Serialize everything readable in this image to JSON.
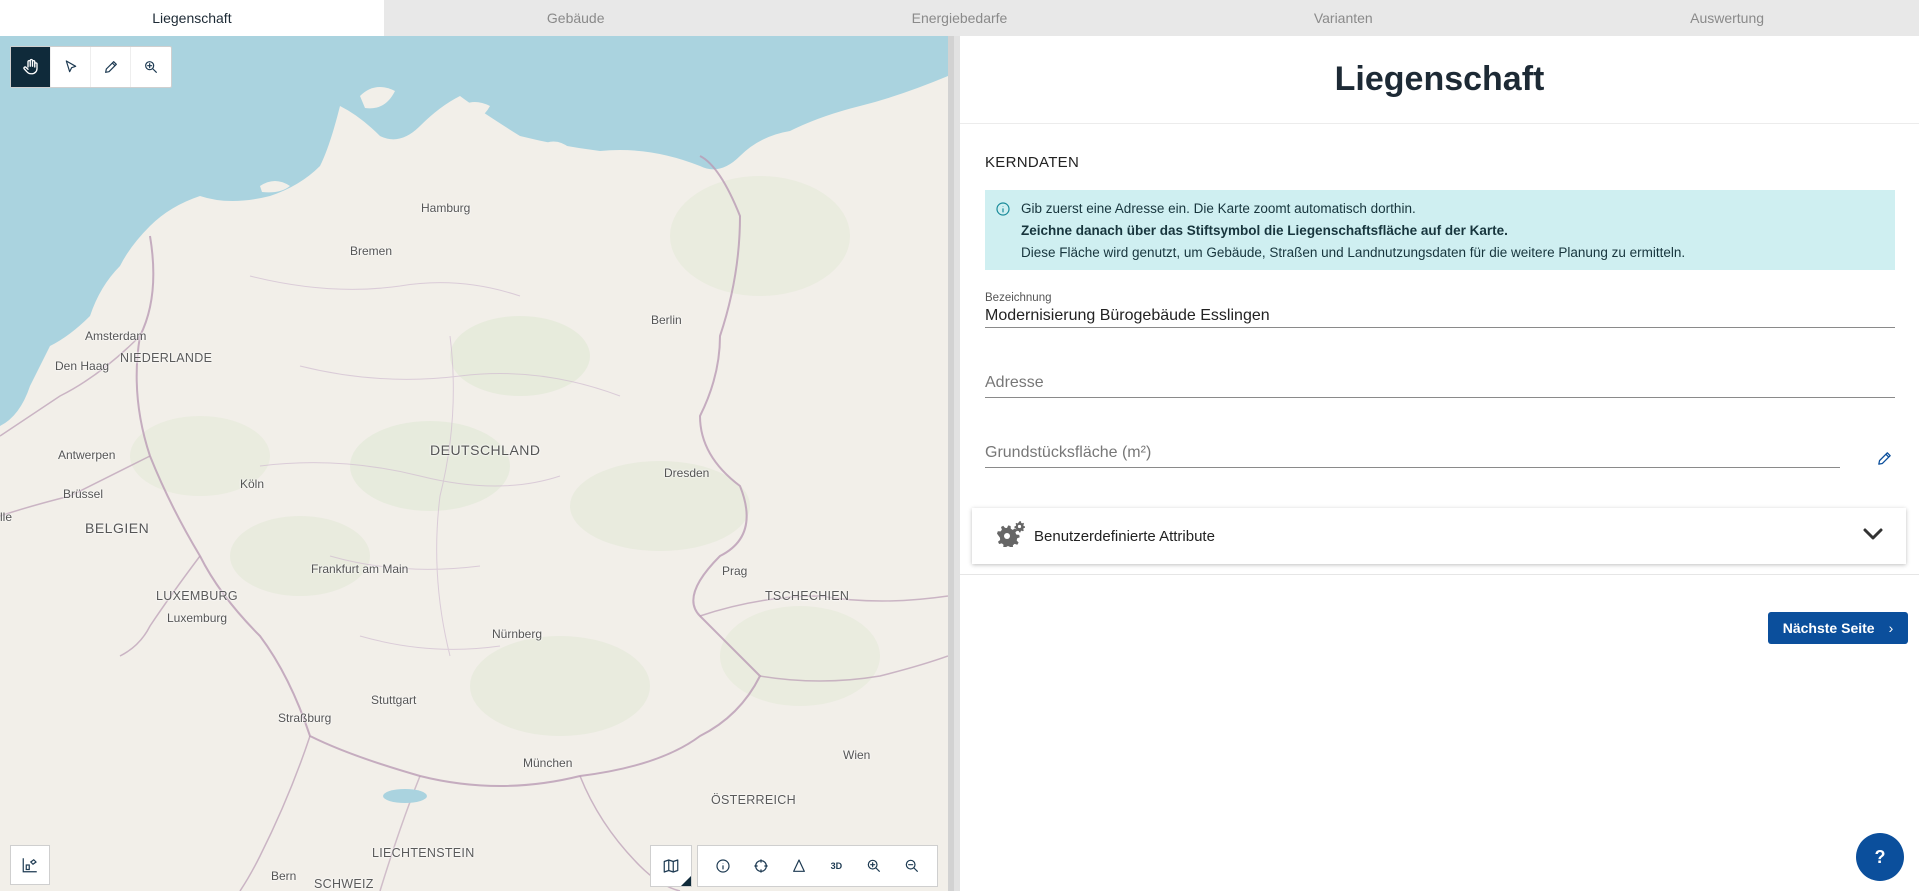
{
  "tabs": [
    {
      "label": "Liegenschaft",
      "active": true
    },
    {
      "label": "Gebäude",
      "active": false
    },
    {
      "label": "Energiebedarfe",
      "active": false
    },
    {
      "label": "Varianten",
      "active": false
    },
    {
      "label": "Auswertung",
      "active": false
    }
  ],
  "map": {
    "tools": [
      "hand-icon",
      "pointer-icon",
      "pencil-icon",
      "zoom-search-icon"
    ],
    "bottom_tools": [
      "info-icon",
      "crosshair-icon",
      "measure-icon",
      "3d-icon",
      "zoom-in-icon",
      "zoom-out-icon"
    ],
    "bottom_3d_label": "3D",
    "labels": {
      "hamburg": "Hamburg",
      "bremen": "Bremen",
      "berlin": "Berlin",
      "amsterdam": "Amsterdam",
      "den_haag": "Den Haag",
      "niederlande": "NIEDERLANDE",
      "deutschland": "DEUTSCHLAND",
      "antwerpen": "Antwerpen",
      "bruessel": "Brüssel",
      "koeln": "Köln",
      "dresden": "Dresden",
      "belgien": "BELGIEN",
      "lille_fragment": "lle",
      "frankfurt": "Frankfurt am Main",
      "prag": "Prag",
      "luxemburg_country": "LUXEMBURG",
      "luxemburg_city": "Luxemburg",
      "tschechien": "TSCHECHIEN",
      "nuernberg": "Nürnberg",
      "stuttgart": "Stuttgart",
      "strassburg": "Straßburg",
      "muenchen": "München",
      "wien": "Wien",
      "oesterreich": "ÖSTERREICH",
      "liechtenstein": "LIECHTENSTEIN",
      "bern": "Bern",
      "schweiz": "SCHWEIZ"
    }
  },
  "panel": {
    "title": "Liegenschaft",
    "section": "KERNDATEN",
    "info": {
      "line1": "Gib zuerst eine Adresse ein. Die Karte zoomt automatisch dorthin.",
      "line2": "Zeichne danach über das Stiftsymbol die Liegenschaftsfläche auf der Karte.",
      "line3": "Diese Fläche wird genutzt, um Gebäude, Straßen und Landnutzungsdaten für die weitere Planung zu ermitteln."
    },
    "bezeichnung": {
      "label": "Bezeichnung",
      "value": "Modernisierung Bürogebäude Esslingen"
    },
    "adresse": {
      "placeholder": "Adresse"
    },
    "grundstueck": {
      "placeholder": "Grundstücksfläche (m²)"
    },
    "attributes_label": "Benutzerdefinierte Attribute",
    "next_button": "Nächste Seite",
    "next_chevron": "›"
  },
  "help_label": "?",
  "colors": {
    "primary": "#0b4f9c",
    "dark": "#0f2a3a",
    "info_bg": "#cfeff1",
    "sea": "#aad3df",
    "land": "#f2efe9"
  }
}
